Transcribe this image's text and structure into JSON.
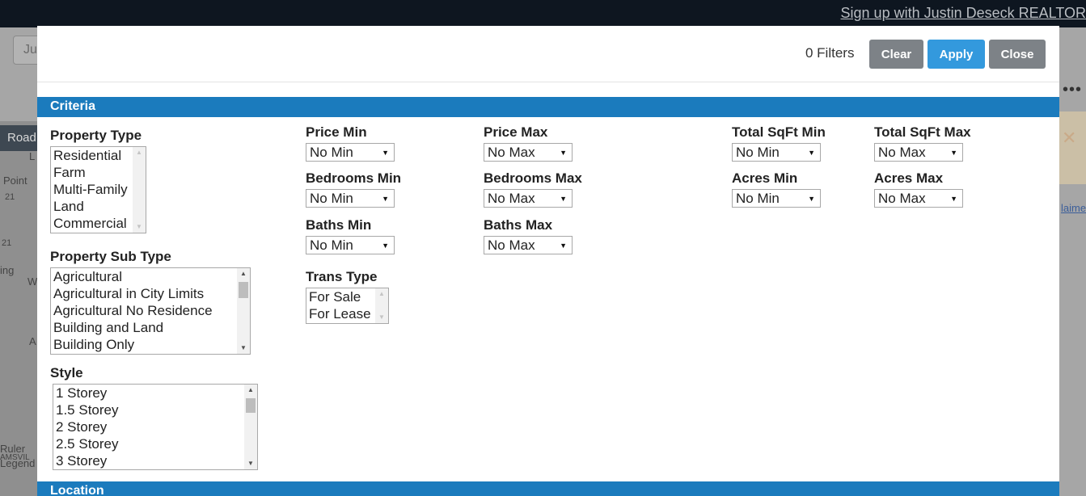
{
  "background": {
    "signup_link": "Sign up with Justin Deseck REALTOR",
    "search_placeholder": "Ju",
    "map_tab": "Road",
    "map_labels": [
      "L",
      "Point",
      "21",
      "21",
      "ing",
      "W",
      "A",
      "Ruler",
      "AMSVIL",
      "Legend"
    ],
    "disclaimer_link": "laimer"
  },
  "modal": {
    "filters_count": "0 Filters",
    "buttons": {
      "clear": "Clear",
      "apply": "Apply",
      "close": "Close"
    },
    "sections": {
      "criteria": "Criteria",
      "location": "Location"
    },
    "criteria": {
      "property_type": {
        "label": "Property Type",
        "options": [
          "Residential",
          "Farm",
          "Multi-Family",
          "Land",
          "Commercial"
        ]
      },
      "property_sub_type": {
        "label": "Property Sub Type",
        "options": [
          "Agricultural",
          "Agricultural in City Limits",
          "Agricultural No Residence",
          "Building and Land",
          "Building Only"
        ]
      },
      "style": {
        "label": "Style",
        "options": [
          "1 Storey",
          "1.5 Storey",
          "2 Storey",
          "2.5 Storey",
          "3 Storey"
        ]
      },
      "trans_type": {
        "label": "Trans Type",
        "options": [
          "For Sale",
          "For Lease"
        ]
      },
      "price_min": {
        "label": "Price Min",
        "value": "No Min"
      },
      "price_max": {
        "label": "Price Max",
        "value": "No Max"
      },
      "bedrooms_min": {
        "label": "Bedrooms Min",
        "value": "No Min"
      },
      "bedrooms_max": {
        "label": "Bedrooms Max",
        "value": "No Max"
      },
      "baths_min": {
        "label": "Baths Min",
        "value": "No Min"
      },
      "baths_max": {
        "label": "Baths Max",
        "value": "No Max"
      },
      "total_sqft_min": {
        "label": "Total SqFt Min",
        "value": "No Min"
      },
      "total_sqft_max": {
        "label": "Total SqFt Max",
        "value": "No Max"
      },
      "acres_min": {
        "label": "Acres Min",
        "value": "No Min"
      },
      "acres_max": {
        "label": "Acres Max",
        "value": "No Max"
      }
    }
  }
}
